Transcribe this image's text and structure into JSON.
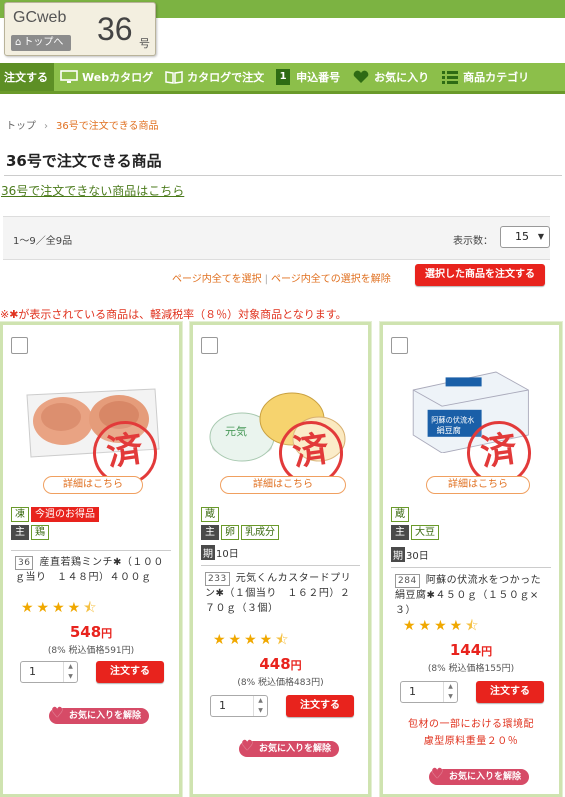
{
  "logo": {
    "brand": "GCweb",
    "home": "トップへ",
    "issue": "36",
    "issue_suffix": "号"
  },
  "nav": [
    {
      "label": "注文する",
      "icon": "cart-icon"
    },
    {
      "label": "Webカタログ",
      "icon": "monitor-icon"
    },
    {
      "label": "カタログで注文",
      "icon": "book-icon"
    },
    {
      "label": "申込番号",
      "icon": "number-icon",
      "num": "1"
    },
    {
      "label": "お気に入り",
      "icon": "heart-icon"
    },
    {
      "label": "商品カテゴリ",
      "icon": "list-icon"
    }
  ],
  "breadcrumb": {
    "home": "トップ",
    "current": "36号で注文できる商品"
  },
  "page_title": "36号で注文できる商品",
  "not_orderable_link": "36号で注文できない商品はこちら",
  "toolbar": {
    "count": "1〜9／全9品",
    "per_page_label": "表示数：",
    "per_page_value": "15",
    "select_all": "ページ内全てを選択",
    "deselect_all": "ページ内全ての選択を解除",
    "order_selected": "選択した商品を注文する"
  },
  "tax_note": "※✱が表示されている商品は、軽減税率（８％）対象商品となります。",
  "common": {
    "detail": "詳細はこちら",
    "order": "注文する",
    "fav_remove": "お気に入りを解除",
    "stamp": "済",
    "yen": "円",
    "period_label": "期"
  },
  "products": [
    {
      "tags1": [
        "凍",
        "今週のお得品"
      ],
      "tags2": [
        "主",
        "鶏"
      ],
      "period": "",
      "number": "36",
      "name": "産直若鶏ミンチ✱（１００ｇ当り　１４８円）４００ｇ",
      "rating": 4.5,
      "price": "548",
      "tax_incl": "(8% 税込価格591円)",
      "qty": "1",
      "eco": ""
    },
    {
      "tags1": [
        "蔵"
      ],
      "tags2": [
        "主",
        "卵",
        "乳成分"
      ],
      "period": "10日",
      "number": "233",
      "name": "元気くんカスタードプリン✱（１個当り　１６２円）２７０ｇ（３個）",
      "rating": 4.5,
      "price": "448",
      "tax_incl": "(8% 税込価格483円)",
      "qty": "1",
      "eco": ""
    },
    {
      "tags1": [
        "蔵"
      ],
      "tags2": [
        "主",
        "大豆"
      ],
      "period": "30日",
      "number": "284",
      "name": "阿蘇の伏流水をつかった絹豆腐✱４５０ｇ（１５０ｇ×３）",
      "rating": 4.5,
      "price": "144",
      "tax_incl": "(8% 税込価格155円)",
      "qty": "1",
      "eco": "包材の一部における環境配慮型原料重量２０％"
    }
  ]
}
